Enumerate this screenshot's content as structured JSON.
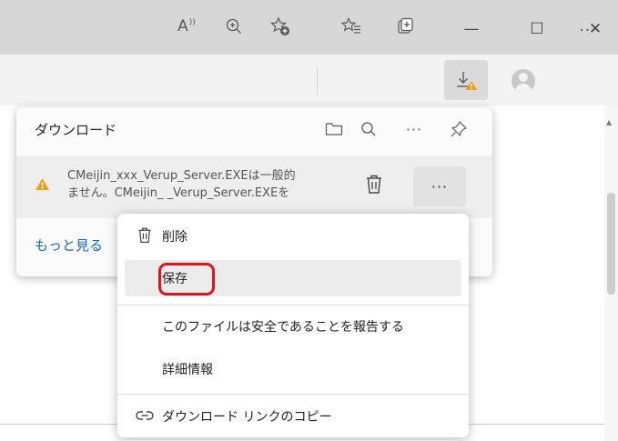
{
  "window_controls": {
    "minimize": "—",
    "maximize": "☐",
    "close": "✕"
  },
  "toolbar": {
    "read_aloud": "A",
    "read_aloud_sup": "))",
    "zoom": "⊕",
    "favorites_menu": "..."
  },
  "downloads_panel": {
    "title": "ダウンロード",
    "item": {
      "line1": "CMeijin_xxx_Verup_Server.EXEは一般的",
      "line2": "ません。CMeijin_     _Verup_Server.EXEを",
      "more": "···"
    },
    "more_link": "もっと見る",
    "header_more": "···"
  },
  "context_menu": {
    "items": [
      {
        "label": "削除"
      },
      {
        "label": "保存"
      },
      {
        "label": "このファイルは安全であることを報告する"
      },
      {
        "label": "詳細情報"
      },
      {
        "label": "ダウンロード リンクのコピー"
      }
    ]
  },
  "colors": {
    "titlebar": "#d7d7d7",
    "toolbar": "#f3f3f3",
    "link": "#1a63c4",
    "warning": "#e8a317",
    "highlight_ring": "#e0141e"
  },
  "icons": [
    "read-aloud-icon",
    "zoom-icon",
    "add-favorite-icon",
    "favorites-icon",
    "collections-icon",
    "downloads-icon",
    "profile-icon",
    "more-icon",
    "folder-icon",
    "search-icon",
    "pin-icon",
    "warning-icon",
    "trash-icon",
    "link-icon"
  ]
}
